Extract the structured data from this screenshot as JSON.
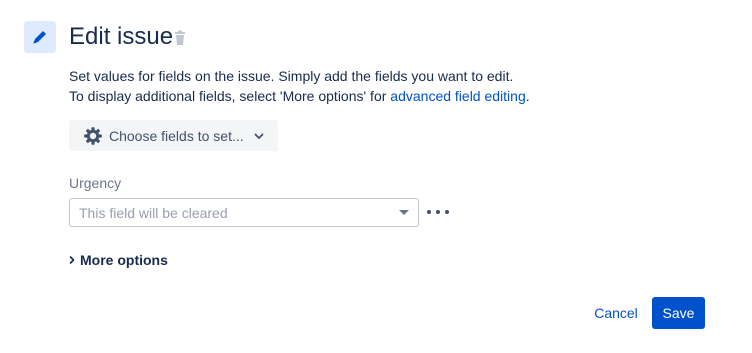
{
  "header": {
    "title": "Edit issue",
    "edit_icon": "pencil-icon",
    "delete_icon": "trash-icon"
  },
  "description": {
    "line1": "Set values for fields on the issue. Simply add the fields you want to edit.",
    "line2_prefix": "To display additional fields, select 'More options' for ",
    "line2_link": "advanced field editing",
    "line2_suffix": "."
  },
  "choose_fields": {
    "label": "Choose fields to set...",
    "icon": "gear-icon",
    "chevron_icon": "chevron-down-icon"
  },
  "urgency": {
    "label": "Urgency",
    "placeholder": "This field will be cleared",
    "more_icon": "more-horizontal-icon"
  },
  "more_options": {
    "label": "More options",
    "icon": "chevron-right-icon"
  },
  "footer": {
    "cancel_label": "Cancel",
    "save_label": "Save"
  },
  "colors": {
    "primary": "#0052cc",
    "icon_tile": "#deebff",
    "text": "#172b4d",
    "muted": "#6b778c"
  }
}
